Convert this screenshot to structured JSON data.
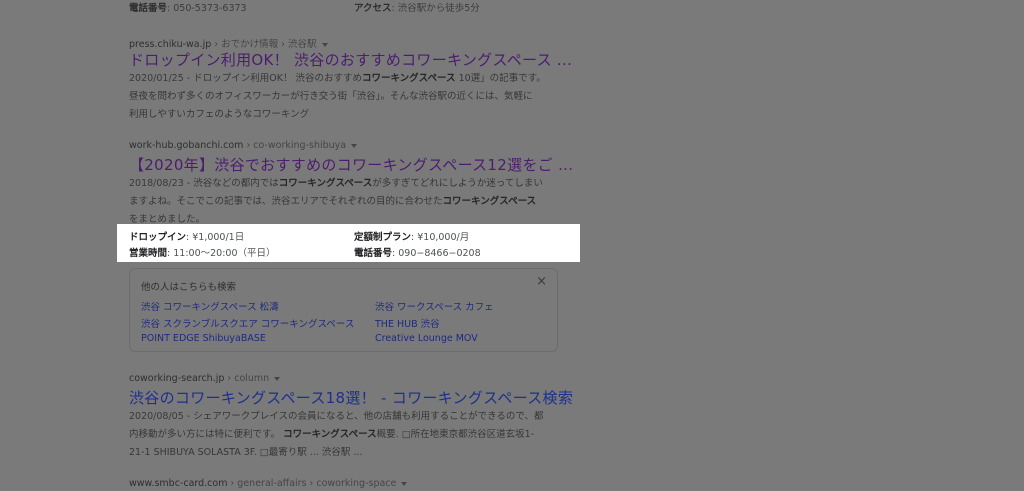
{
  "top_info": {
    "phone_label": "電話番号",
    "phone_value": ": 050-5373-6373",
    "access_label": "アクセス",
    "access_value": ": 渋谷駅から徒歩5分"
  },
  "results": [
    {
      "domain": "press.chiku-wa.jp",
      "path": " › おでかけ情報 › 渋谷駅",
      "title": "ドロップイン利用OK！ 渋谷のおすすめコワーキングスペース ...",
      "snippet": [
        "2020/01/25 - ドロップイン利用OK！ 渋谷のおすすめコワーキングスペース 10選」の記事です。",
        "昼夜を問わず多くのオフィスワーカーが行き交う街「渋谷」。そんな渋谷駅の近くには、気軽に",
        "利用しやすいカフェのようなコワーキング"
      ]
    },
    {
      "domain": "work-hub.gobanchi.com",
      "path": " › co-working-shibuya",
      "title": "【2020年】渋谷でおすすめのコワーキングスペース12選をご ...",
      "snippet": [
        "2018/08/23 - 渋谷などの都内ではコワーキングスペースが多すぎてどれにしようか迷ってしまい",
        "ますよね。そこでこの記事では、渋谷エリアでそれぞれの目的に合わせたコワーキングスペース",
        "をまとめました。"
      ],
      "details": [
        {
          "label": "ドロップイン",
          "value": ": ¥1,000/1日"
        },
        {
          "label": "定額制プラン",
          "value": ": ¥10,000/月"
        },
        {
          "label": "営業時間",
          "value": ": 11:00～20:00（平日）"
        },
        {
          "label": "電話番号",
          "value": ": 090−8466−0208"
        }
      ]
    },
    {
      "domain": "coworking-search.jp",
      "path": " › column",
      "title": "渋谷のコワーキングスペース18選！ - コワーキングスペース検索",
      "snippet": [
        "2020/08/05 - シェアワークプレイスの会員になると、他の店舗も利用することができるので、都",
        "内移動が多い方には特に便利です。 コワーキングスペース概要. □所在地東京都渋谷区道玄坂1-",
        "21-1 SHIBUYA SOLASTA 3F. □最寄り駅 ... 渋谷駅 ..."
      ]
    },
    {
      "domain": "www.smbc-card.com",
      "path": " › general-affairs › coworking-space"
    }
  ],
  "people_also_search": {
    "title": "他の人はこちらも検索",
    "close_icon": "×",
    "links": [
      "渋谷 コワーキングスペース 松濤",
      "渋谷 ワークスペース カフェ",
      "渋谷 スクランブルスクエア コワーキングスペース",
      "THE HUB 渋谷",
      "POINT EDGE ShibuyaBASE",
      "Creative Lounge MOV"
    ]
  }
}
